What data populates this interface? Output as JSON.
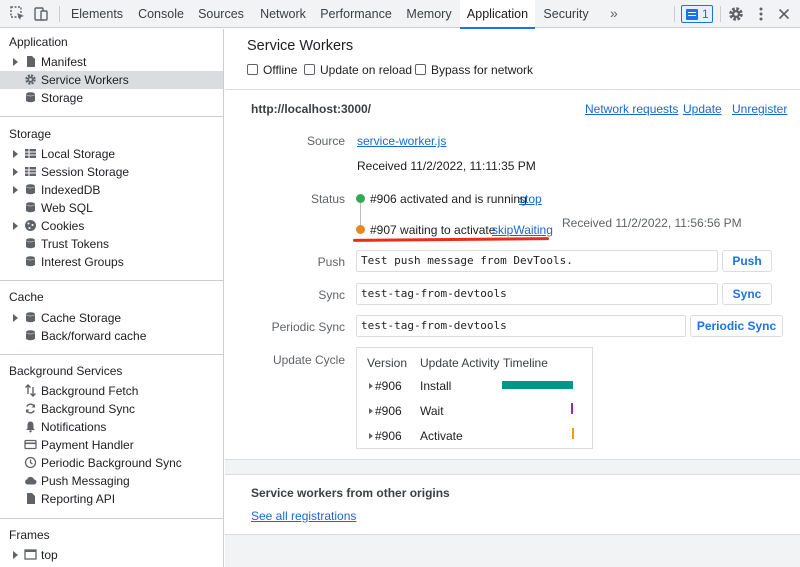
{
  "tabs": [
    {
      "label": "Elements",
      "active": false
    },
    {
      "label": "Console",
      "active": false
    },
    {
      "label": "Sources",
      "active": false
    },
    {
      "label": "Network",
      "active": false
    },
    {
      "label": "Performance",
      "active": false
    },
    {
      "label": "Memory",
      "active": false
    },
    {
      "label": "Application",
      "active": true
    },
    {
      "label": "Security",
      "active": false
    }
  ],
  "more_tabs": "»",
  "issues_count": "1",
  "sidebar": {
    "sections": [
      {
        "title": "Application",
        "items": [
          {
            "label": "Manifest",
            "icon": "file-icon",
            "arrow": true,
            "selected": false
          },
          {
            "label": "Service Workers",
            "icon": "gear-icon",
            "arrow": false,
            "selected": true
          },
          {
            "label": "Storage",
            "icon": "database-icon",
            "arrow": false,
            "selected": false
          }
        ]
      },
      {
        "title": "Storage",
        "items": [
          {
            "label": "Local Storage",
            "icon": "grid-icon",
            "arrow": true
          },
          {
            "label": "Session Storage",
            "icon": "grid-icon",
            "arrow": true
          },
          {
            "label": "IndexedDB",
            "icon": "database-icon",
            "arrow": true
          },
          {
            "label": "Web SQL",
            "icon": "database-icon",
            "arrow": false
          },
          {
            "label": "Cookies",
            "icon": "cookie-icon",
            "arrow": true
          },
          {
            "label": "Trust Tokens",
            "icon": "database-icon",
            "arrow": false
          },
          {
            "label": "Interest Groups",
            "icon": "database-icon",
            "arrow": false
          }
        ]
      },
      {
        "title": "Cache",
        "items": [
          {
            "label": "Cache Storage",
            "icon": "database-icon",
            "arrow": true
          },
          {
            "label": "Back/forward cache",
            "icon": "database-icon",
            "arrow": false
          }
        ]
      },
      {
        "title": "Background Services",
        "items": [
          {
            "label": "Background Fetch",
            "icon": "updown-arrows-icon",
            "arrow": false
          },
          {
            "label": "Background Sync",
            "icon": "sync-icon",
            "arrow": false
          },
          {
            "label": "Notifications",
            "icon": "bell-icon",
            "arrow": false
          },
          {
            "label": "Payment Handler",
            "icon": "card-icon",
            "arrow": false
          },
          {
            "label": "Periodic Background Sync",
            "icon": "clock-icon",
            "arrow": false
          },
          {
            "label": "Push Messaging",
            "icon": "cloud-icon",
            "arrow": false
          },
          {
            "label": "Reporting API",
            "icon": "file-icon",
            "arrow": false
          }
        ]
      },
      {
        "title": "Frames",
        "items": [
          {
            "label": "top",
            "icon": "frame-icon",
            "arrow": true
          }
        ]
      }
    ]
  },
  "main": {
    "title": "Service Workers",
    "options": [
      "Offline",
      "Update on reload",
      "Bypass for network"
    ],
    "origin": "http://localhost:3000/",
    "links": {
      "network_requests": "Network requests",
      "update": "Update",
      "unregister": "Unregister"
    },
    "source_label": "Source",
    "source_link": "service-worker.js",
    "received": "Received 11/2/2022, 11:11:35 PM",
    "status_label": "Status",
    "status1_text": "#906 activated and is running",
    "status1_action": "stop",
    "status1_color": "#34a853",
    "status2_text": "#907 waiting to activate",
    "status2_action": "skipWaiting",
    "status2_color": "#e8871e",
    "status2_received": "Received 11/2/2022, 11:56:56 PM",
    "push_label": "Push",
    "push_value": "Test push message from DevTools.",
    "push_button": "Push",
    "sync_label": "Sync",
    "sync_value": "test-tag-from-devtools",
    "sync_button": "Sync",
    "periodic_label": "Periodic Sync",
    "periodic_value": "test-tag-from-devtools",
    "periodic_button": "Periodic Sync",
    "update_cycle_label": "Update Cycle",
    "update_cycle": {
      "headers": [
        "Version",
        "Update Activity",
        "Timeline"
      ],
      "rows": [
        {
          "version": "#906",
          "activity": "Install",
          "bar_color": "#009688"
        },
        {
          "version": "#906",
          "activity": "Wait",
          "bar_color": "#9c27b0"
        },
        {
          "version": "#906",
          "activity": "Activate",
          "bar_color": "#f29900"
        }
      ]
    },
    "other_origins_title": "Service workers from other origins",
    "see_all": "See all registrations"
  }
}
